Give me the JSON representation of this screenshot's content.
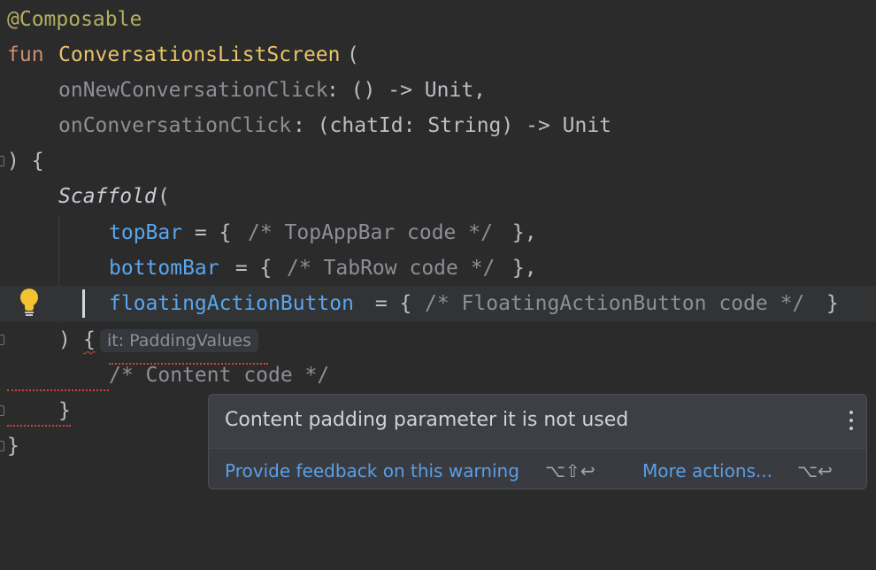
{
  "editor": {
    "line1": {
      "annotation": "@Composable"
    },
    "line2": {
      "keyword": "fun",
      "name": "ConversationsListScreen",
      "paren": "("
    },
    "line3": {
      "param": "onNewConversationClick",
      "rest": ": () -> Unit,"
    },
    "line4": {
      "param": "onConversationClick",
      "rest": ": (chatId: String) -> Unit"
    },
    "line5": {
      "text": ") {"
    },
    "line6": {
      "call": "Scaffold",
      "paren": "("
    },
    "line7": {
      "arg": "topBar",
      "eq": " = { ",
      "comment": "/* TopAppBar code */",
      "end": " },"
    },
    "line8": {
      "arg": "bottomBar",
      "eq": " = { ",
      "comment": "/* TabRow code */",
      "end": " },"
    },
    "line9": {
      "arg": "floatingActionButton",
      "eq": " = { ",
      "comment": "/* FloatingActionButton code */",
      "end": " }"
    },
    "line10": {
      "close": ")",
      "brace": "{",
      "hint": "it: PaddingValues"
    },
    "line11": {
      "comment": "/* Content code */"
    },
    "line12": {
      "text": "}"
    },
    "line13": {
      "text": "}"
    }
  },
  "popup": {
    "message": "Content padding parameter it is not used",
    "feedback_link": "Provide feedback on this warning",
    "feedback_shortcut": "⌥⇧↩",
    "more_link": "More actions...",
    "more_shortcut": "⌥↩"
  },
  "colors": {
    "background": "#2b2b2b",
    "keyword": "#cf8e6d",
    "function": "#e8c46a",
    "annotation": "#b3ae60",
    "named_argument": "#5aa6ee",
    "error_underline": "#d0453a",
    "link": "#5a9fe6"
  }
}
